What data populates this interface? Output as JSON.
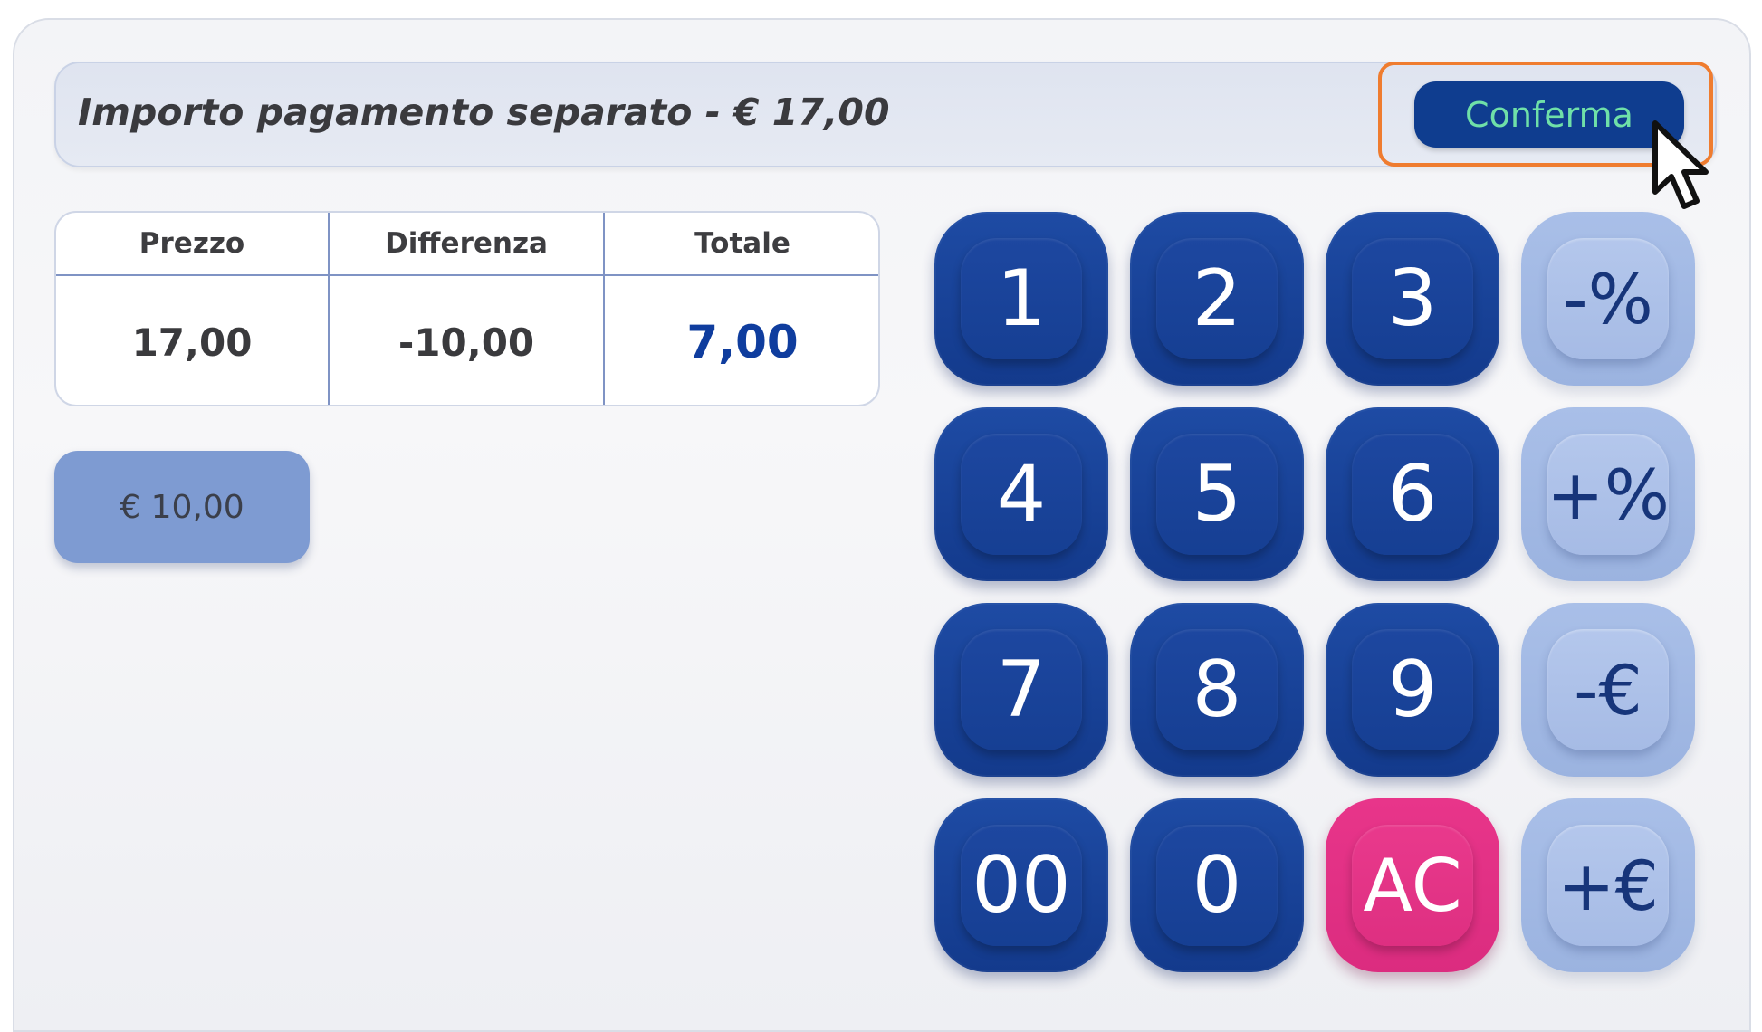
{
  "header": {
    "title": "Importo pagamento separato - € 17,00",
    "confirm_label": "Conferma"
  },
  "summary": {
    "columns": [
      "Prezzo",
      "Differenza",
      "Totale"
    ],
    "values": [
      "17,00",
      "-10,00",
      "7,00"
    ]
  },
  "amount_chip": "€ 10,00",
  "keypad": {
    "rows": [
      [
        "1",
        "2",
        "3",
        "-%"
      ],
      [
        "4",
        "5",
        "6",
        "+%"
      ],
      [
        "7",
        "8",
        "9",
        "-€"
      ],
      [
        "00",
        "0",
        "AC",
        "+€"
      ]
    ]
  },
  "colors": {
    "accent_dark": "#133a8c",
    "accent_light": "#a9bfe8",
    "clear_key": "#e0317f",
    "confirm_text": "#6fe0a8",
    "highlight": "#ef7c2f"
  },
  "icons": {
    "cursor": "mouse-pointer-icon"
  }
}
